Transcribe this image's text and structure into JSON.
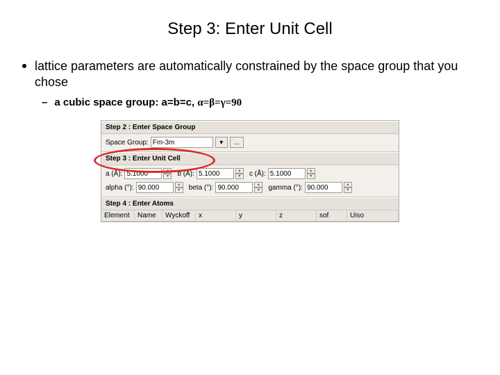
{
  "title": "Step 3: Enter Unit Cell",
  "bullet1": "lattice parameters are automatically constrained by the space group that you chose",
  "bullet2_prefix": "a cubic space group: a=b=c, ",
  "bullet2_greek": "α=β=γ=90",
  "panel": {
    "step2": {
      "header": "Step 2 : Enter Space Group",
      "label": "Space Group:",
      "value": "Fm-3m",
      "down": "▾",
      "dots": "..."
    },
    "step3": {
      "header": "Step 3 : Enter Unit Cell",
      "a_label": "a (Å):",
      "a_value": "5.1000",
      "b_label": "b (Å):",
      "b_value": "5.1000",
      "c_label": "c (Å):",
      "c_value": "5.1000",
      "alpha_label": "alpha (°):",
      "alpha_value": "90.000",
      "beta_label": "beta (°):",
      "beta_value": "90.000",
      "gamma_label": "gamma (°):",
      "gamma_value": "90.000"
    },
    "step4": {
      "header": "Step 4 : Enter Atoms",
      "cols": [
        "Element",
        "Name",
        "Wyckoff",
        "x",
        "y",
        "z",
        "sof",
        "Uiso"
      ]
    }
  }
}
